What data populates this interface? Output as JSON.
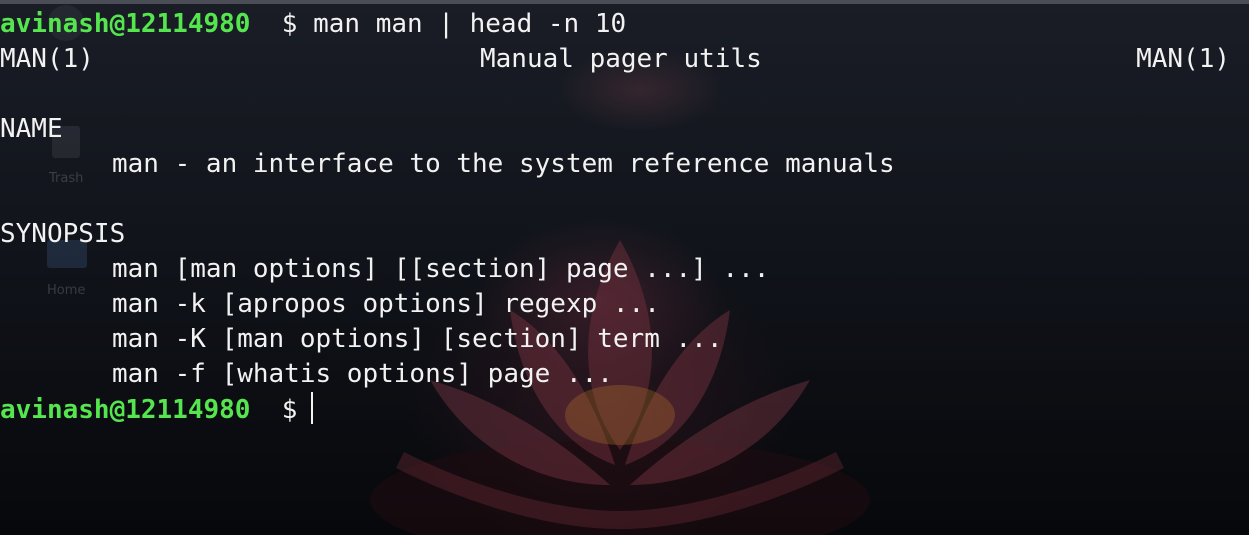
{
  "desktop": {
    "trash_label": "Trash",
    "home_label": "Home"
  },
  "terminal": {
    "prompt_user": "avinash@12114980",
    "prompt_symbol": "$",
    "command": "man man | head -n 10",
    "header": {
      "left": "MAN(1)",
      "center": "Manual pager utils",
      "right": "MAN(1)"
    },
    "name_heading": "NAME",
    "name_desc": "man - an interface to the system reference manuals",
    "synopsis_heading": "SYNOPSIS",
    "synopsis_lines": [
      "man [man options] [[section] page ...] ...",
      "man -k [apropos options] regexp ...",
      "man -K [man options] [section] term ...",
      "man -f [whatis options] page ..."
    ]
  },
  "colors": {
    "prompt_user": "#55e64f",
    "text": "#f2f2f2",
    "background": "#0a0c10"
  }
}
